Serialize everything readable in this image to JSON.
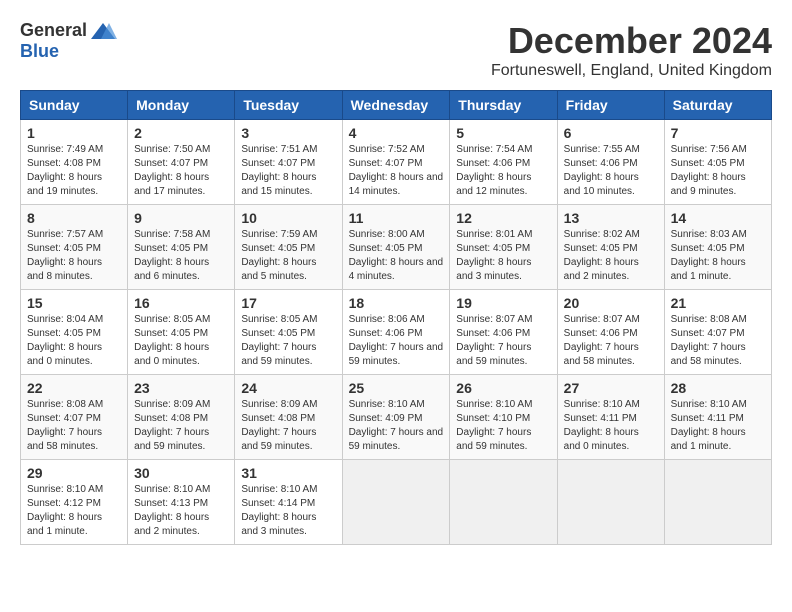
{
  "header": {
    "logo_general": "General",
    "logo_blue": "Blue",
    "month_title": "December 2024",
    "location": "Fortuneswell, England, United Kingdom"
  },
  "days_of_week": [
    "Sunday",
    "Monday",
    "Tuesday",
    "Wednesday",
    "Thursday",
    "Friday",
    "Saturday"
  ],
  "weeks": [
    [
      {
        "day": "1",
        "sunrise": "Sunrise: 7:49 AM",
        "sunset": "Sunset: 4:08 PM",
        "daylight": "Daylight: 8 hours and 19 minutes."
      },
      {
        "day": "2",
        "sunrise": "Sunrise: 7:50 AM",
        "sunset": "Sunset: 4:07 PM",
        "daylight": "Daylight: 8 hours and 17 minutes."
      },
      {
        "day": "3",
        "sunrise": "Sunrise: 7:51 AM",
        "sunset": "Sunset: 4:07 PM",
        "daylight": "Daylight: 8 hours and 15 minutes."
      },
      {
        "day": "4",
        "sunrise": "Sunrise: 7:52 AM",
        "sunset": "Sunset: 4:07 PM",
        "daylight": "Daylight: 8 hours and 14 minutes."
      },
      {
        "day": "5",
        "sunrise": "Sunrise: 7:54 AM",
        "sunset": "Sunset: 4:06 PM",
        "daylight": "Daylight: 8 hours and 12 minutes."
      },
      {
        "day": "6",
        "sunrise": "Sunrise: 7:55 AM",
        "sunset": "Sunset: 4:06 PM",
        "daylight": "Daylight: 8 hours and 10 minutes."
      },
      {
        "day": "7",
        "sunrise": "Sunrise: 7:56 AM",
        "sunset": "Sunset: 4:05 PM",
        "daylight": "Daylight: 8 hours and 9 minutes."
      }
    ],
    [
      {
        "day": "8",
        "sunrise": "Sunrise: 7:57 AM",
        "sunset": "Sunset: 4:05 PM",
        "daylight": "Daylight: 8 hours and 8 minutes."
      },
      {
        "day": "9",
        "sunrise": "Sunrise: 7:58 AM",
        "sunset": "Sunset: 4:05 PM",
        "daylight": "Daylight: 8 hours and 6 minutes."
      },
      {
        "day": "10",
        "sunrise": "Sunrise: 7:59 AM",
        "sunset": "Sunset: 4:05 PM",
        "daylight": "Daylight: 8 hours and 5 minutes."
      },
      {
        "day": "11",
        "sunrise": "Sunrise: 8:00 AM",
        "sunset": "Sunset: 4:05 PM",
        "daylight": "Daylight: 8 hours and 4 minutes."
      },
      {
        "day": "12",
        "sunrise": "Sunrise: 8:01 AM",
        "sunset": "Sunset: 4:05 PM",
        "daylight": "Daylight: 8 hours and 3 minutes."
      },
      {
        "day": "13",
        "sunrise": "Sunrise: 8:02 AM",
        "sunset": "Sunset: 4:05 PM",
        "daylight": "Daylight: 8 hours and 2 minutes."
      },
      {
        "day": "14",
        "sunrise": "Sunrise: 8:03 AM",
        "sunset": "Sunset: 4:05 PM",
        "daylight": "Daylight: 8 hours and 1 minute."
      }
    ],
    [
      {
        "day": "15",
        "sunrise": "Sunrise: 8:04 AM",
        "sunset": "Sunset: 4:05 PM",
        "daylight": "Daylight: 8 hours and 0 minutes."
      },
      {
        "day": "16",
        "sunrise": "Sunrise: 8:05 AM",
        "sunset": "Sunset: 4:05 PM",
        "daylight": "Daylight: 8 hours and 0 minutes."
      },
      {
        "day": "17",
        "sunrise": "Sunrise: 8:05 AM",
        "sunset": "Sunset: 4:05 PM",
        "daylight": "Daylight: 7 hours and 59 minutes."
      },
      {
        "day": "18",
        "sunrise": "Sunrise: 8:06 AM",
        "sunset": "Sunset: 4:06 PM",
        "daylight": "Daylight: 7 hours and 59 minutes."
      },
      {
        "day": "19",
        "sunrise": "Sunrise: 8:07 AM",
        "sunset": "Sunset: 4:06 PM",
        "daylight": "Daylight: 7 hours and 59 minutes."
      },
      {
        "day": "20",
        "sunrise": "Sunrise: 8:07 AM",
        "sunset": "Sunset: 4:06 PM",
        "daylight": "Daylight: 7 hours and 58 minutes."
      },
      {
        "day": "21",
        "sunrise": "Sunrise: 8:08 AM",
        "sunset": "Sunset: 4:07 PM",
        "daylight": "Daylight: 7 hours and 58 minutes."
      }
    ],
    [
      {
        "day": "22",
        "sunrise": "Sunrise: 8:08 AM",
        "sunset": "Sunset: 4:07 PM",
        "daylight": "Daylight: 7 hours and 58 minutes."
      },
      {
        "day": "23",
        "sunrise": "Sunrise: 8:09 AM",
        "sunset": "Sunset: 4:08 PM",
        "daylight": "Daylight: 7 hours and 59 minutes."
      },
      {
        "day": "24",
        "sunrise": "Sunrise: 8:09 AM",
        "sunset": "Sunset: 4:08 PM",
        "daylight": "Daylight: 7 hours and 59 minutes."
      },
      {
        "day": "25",
        "sunrise": "Sunrise: 8:10 AM",
        "sunset": "Sunset: 4:09 PM",
        "daylight": "Daylight: 7 hours and 59 minutes."
      },
      {
        "day": "26",
        "sunrise": "Sunrise: 8:10 AM",
        "sunset": "Sunset: 4:10 PM",
        "daylight": "Daylight: 7 hours and 59 minutes."
      },
      {
        "day": "27",
        "sunrise": "Sunrise: 8:10 AM",
        "sunset": "Sunset: 4:11 PM",
        "daylight": "Daylight: 8 hours and 0 minutes."
      },
      {
        "day": "28",
        "sunrise": "Sunrise: 8:10 AM",
        "sunset": "Sunset: 4:11 PM",
        "daylight": "Daylight: 8 hours and 1 minute."
      }
    ],
    [
      {
        "day": "29",
        "sunrise": "Sunrise: 8:10 AM",
        "sunset": "Sunset: 4:12 PM",
        "daylight": "Daylight: 8 hours and 1 minute."
      },
      {
        "day": "30",
        "sunrise": "Sunrise: 8:10 AM",
        "sunset": "Sunset: 4:13 PM",
        "daylight": "Daylight: 8 hours and 2 minutes."
      },
      {
        "day": "31",
        "sunrise": "Sunrise: 8:10 AM",
        "sunset": "Sunset: 4:14 PM",
        "daylight": "Daylight: 8 hours and 3 minutes."
      },
      null,
      null,
      null,
      null
    ]
  ]
}
